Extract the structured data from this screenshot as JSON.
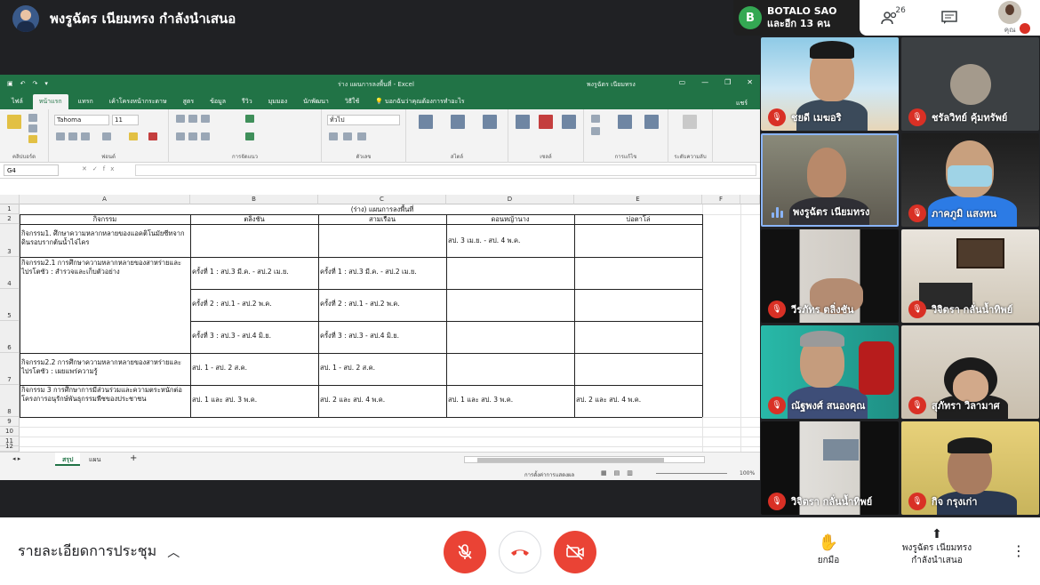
{
  "presenter_banner": {
    "text": "พงรูฉัตร เนียมทรง กำลังนำเสนอ"
  },
  "top_right": {
    "other_participant_initial": "B",
    "other_participant_name": "BOTALO SAO",
    "others_count_text": "และอีก 13 คน",
    "people_icon": "people-icon",
    "people_count": "26",
    "chat_icon": "chat-icon",
    "you_label": "คุณ"
  },
  "excel": {
    "doc_title": "ร่าง แผนการลงพื้นที่ - Excel",
    "user_name": "พงรูฉัตร เนียมทรง",
    "share_label": "แชร์",
    "tell_me": "บอกฉันว่าคุณต้องการทำอะไร",
    "ribbon_tabs": [
      "ไฟล์",
      "หน้าแรก",
      "แทรก",
      "เค้าโครงหน้ากระดาษ",
      "สูตร",
      "ข้อมูล",
      "รีวิว",
      "มุมมอง",
      "นักพัฒนา",
      "วิธีใช้"
    ],
    "font_name": "Tahoma",
    "font_size": "11",
    "number_format": "ทั่วไป",
    "ribbon_groups": [
      "คลิปบอร์ด",
      "ฟอนต์",
      "การจัดแนว",
      "ตัวเลข",
      "สไตล์",
      "เซลล์",
      "การแก้ไข",
      "ระดับความลับ"
    ],
    "name_box": "G4",
    "column_headers": [
      "A",
      "B",
      "C",
      "D",
      "E",
      "F"
    ],
    "row_numbers": [
      "1",
      "2",
      "3",
      "4",
      "5",
      "6",
      "7",
      "8",
      "9",
      "10",
      "11",
      "12"
    ],
    "sheet_title": "(ร่าง) แผนการลงพื้นที่",
    "table_headers": [
      "กิจกรรม",
      "ตลิ่งชัน",
      "สามเรือน",
      "ดอนหญ้านาง",
      "บ่อตาโล่"
    ],
    "rows": [
      {
        "activity": "กิจกรรม1. ศึกษาความหลากหลายของแอคติโนมัยซีทจากดินรอบรากต้นน้ำไจ่ไคร",
        "b": "",
        "c": "",
        "d": "สป. 3 เม.ย. - สป. 4 พ.ค.",
        "e": ""
      },
      {
        "activity": "กิจกรรม2.1 การศึกษาความหลากหลายของสาหร่ายและไปรโตซัว : สำรวจและเก็บตัวอย่าง",
        "b": "ครั้งที่ 1 : สป.3 มี.ค. - สป.2 เม.ย.",
        "c": "ครั้งที่ 1 : สป.3 มี.ค. - สป.2 เม.ย.",
        "d": "",
        "e": ""
      },
      {
        "activity": "",
        "b": "ครั้งที่ 2 : สป.1 - สป.2 พ.ค.",
        "c": "ครั้งที่ 2 : สป.1 - สป.2 พ.ค.",
        "d": "",
        "e": ""
      },
      {
        "activity": "",
        "b": "ครั้งที่ 3 : สป.3 - สป.4 มิ.ย.",
        "c": "ครั้งที่ 3 : สป.3 - สป.4 มิ.ย.",
        "d": "",
        "e": ""
      },
      {
        "activity": "กิจกรรม2.2 การศึกษาความหลากหลายของสาหร่ายและไปรโตซัว : เผยแพร่ความรู้",
        "b": "สป. 1 - สป. 2 ส.ค.",
        "c": "สป. 1 - สป. 2 ส.ค.",
        "d": "",
        "e": ""
      },
      {
        "activity": "กิจกรรม 3 การศึกษาการมีส่วนร่วมและความตระหนักต่อโครงการอนุรักษ์พันธุกรรมพืชของประชาชน",
        "b": "สป. 1 และ สป. 3 พ.ค.",
        "c": "สป. 2 และ สป. 4 พ.ค.",
        "d": "สป. 1 และ สป. 3 พ.ค.",
        "e": "สป. 2 และ สป. 4 พ.ค."
      }
    ],
    "sheet_tabs": [
      "สรุป",
      "แผน"
    ],
    "add_sheet": "+",
    "status_settings": "การตั้งค่าการแสดงผล",
    "zoom": "100%"
  },
  "tiles": [
    {
      "name": "ชยดี เมฆอริ",
      "muted": true
    },
    {
      "name": "ชรัลวิทย์ คุ้มทรัพย์",
      "muted": true
    },
    {
      "name": "พงรูฉัตร เนียมทรง",
      "muted": false
    },
    {
      "name": "ภาคภูมิ แสงทน",
      "muted": true
    },
    {
      "name": "วีรภัทร ตลิ่งชัน",
      "muted": true
    },
    {
      "name": "วิจิตรา กลั่นน้ำทิพย์",
      "muted": true
    },
    {
      "name": "ณัฐพงศ์ สนองคุณ",
      "muted": true
    },
    {
      "name": "สุภัทรา วิลามาศ",
      "muted": true
    },
    {
      "name": "วิจิตรา กลั่นน้ำทิพย์",
      "muted": true
    },
    {
      "name": "กิจ กรุงเก่า",
      "muted": true
    }
  ],
  "bottom": {
    "meeting_details": "รายละเอียดการประชุม",
    "raise_hand": "ยกมือ",
    "present_line1": "พงรูฉัตร เนียมทรง",
    "present_line2": "กำลังนำเสนอ"
  },
  "colors": {
    "excel_green": "#217346",
    "meet_red": "#ea4335",
    "dark_bg": "#202124"
  }
}
